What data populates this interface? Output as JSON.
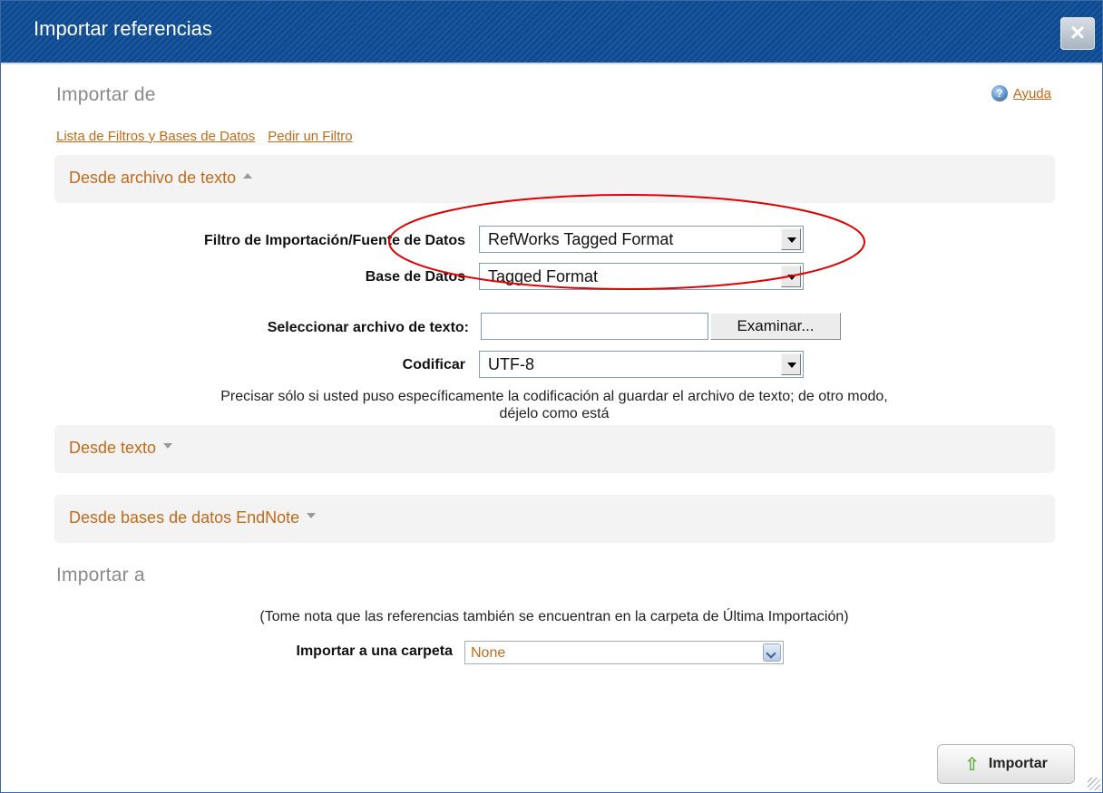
{
  "dialog": {
    "title": "Importar referencias",
    "close_icon": "close-icon"
  },
  "importar_de": {
    "heading": "Importar de",
    "help_label": "Ayuda",
    "help_icon": "help-icon",
    "links": [
      "Lista de Filtros y Bases de Datos",
      "Pedir un Filtro"
    ]
  },
  "from_text_file": {
    "title": "Desde archivo de texto",
    "filter_label": "Filtro de Importación/Fuente de Datos",
    "filter_value": "RefWorks Tagged Format",
    "database_label": "Base de Datos",
    "database_value": "Tagged Format",
    "file_label": "Seleccionar archivo de texto:",
    "file_value": "",
    "browse_label": "Examinar...",
    "encoding_label": "Codificar",
    "encoding_value": "UTF-8",
    "encoding_note_line1": "Precisar sólo si usted puso específicamente la codificación al guardar el archivo de texto; de otro modo,",
    "encoding_note_line2": "déjelo como está"
  },
  "from_text": {
    "title": "Desde texto"
  },
  "from_endnote": {
    "title": "Desde bases de datos EndNote"
  },
  "importar_a": {
    "heading": "Importar a",
    "note": "(Tome nota que las referencias también se encuentran en la carpeta de Última Importación)",
    "folder_label": "Importar a una carpeta",
    "folder_value": "None"
  },
  "footer": {
    "import_label": "Importar",
    "import_icon": "up-arrow-icon"
  },
  "annotation": {
    "color": "#e00000"
  },
  "colors": {
    "titlebar": "#0d4a92",
    "link": "#c26a17"
  }
}
